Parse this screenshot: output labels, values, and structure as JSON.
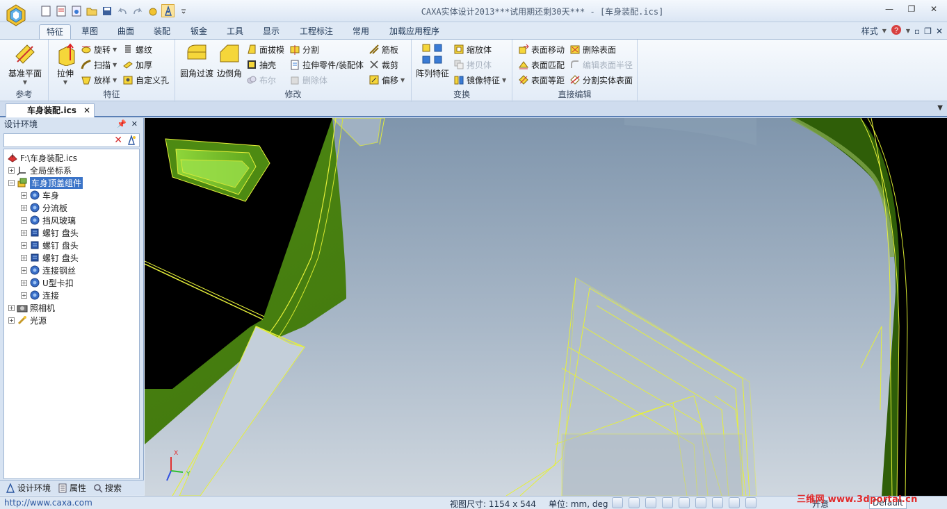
{
  "window": {
    "title": "CAXA实体设计2013***试用期还剩30天*** - [车身装配.ics]"
  },
  "ribbon_tabs": [
    "特征",
    "草图",
    "曲面",
    "装配",
    "钣金",
    "工具",
    "显示",
    "工程标注",
    "常用",
    "加载应用程序"
  ],
  "ribbon_right": {
    "style_label": "样式"
  },
  "groups": {
    "reference": {
      "label": "参考",
      "plane": "基准平面"
    },
    "feature": {
      "label": "特征",
      "extrude": "拉伸",
      "revolve": "旋转",
      "sweep": "扫描",
      "loft": "放样",
      "thread": "螺纹",
      "thicken": "加厚",
      "custom_hole": "自定义孔"
    },
    "modify": {
      "label": "修改",
      "fillet": "圆角过渡",
      "chamfer": "边倒角",
      "draft": "面拔模",
      "shell": "抽壳",
      "boolean": "布尔",
      "split": "分割",
      "pull_part": "拉伸零件/装配体",
      "delete_body": "删除体",
      "rib": "筋板",
      "trim": "裁剪",
      "offset": "偏移"
    },
    "transform": {
      "label": "变换",
      "pattern": "阵列特征",
      "scale": "缩放体",
      "copy": "拷贝体",
      "mirror": "镜像特征"
    },
    "direct_edit": {
      "label": "直接编辑",
      "move_face": "表面移动",
      "match_face": "表面匹配",
      "offset_face": "表面等距",
      "delete_face": "删除表面",
      "edit_radius": "编辑表面半径",
      "split_solid": "分割实体表面"
    }
  },
  "document_tab": {
    "label": "车身装配.ics"
  },
  "panel": {
    "title": "设计环境",
    "tree": {
      "root": "F:\\车身装配.ics",
      "items": [
        {
          "label": "全局坐标系",
          "level": 1
        },
        {
          "label": "车身顶盖组件",
          "level": 1,
          "selected": true
        },
        {
          "label": "车身",
          "level": 2
        },
        {
          "label": "分流板",
          "level": 2
        },
        {
          "label": "挡风玻璃",
          "level": 2
        },
        {
          "label": "螺钉  盘头",
          "level": 2
        },
        {
          "label": "螺钉  盘头",
          "level": 2
        },
        {
          "label": "螺钉  盘头",
          "level": 2
        },
        {
          "label": "连接钢丝",
          "level": 2
        },
        {
          "label": "U型卡扣",
          "level": 2
        },
        {
          "label": "连接",
          "level": 2
        },
        {
          "label": "照相机",
          "level": 1
        },
        {
          "label": "光源",
          "level": 1
        }
      ]
    },
    "footer_tabs": [
      "设计环境",
      "属性",
      "搜索"
    ]
  },
  "viewport": {
    "axis_x": "X",
    "axis_y": "Y"
  },
  "statusbar": {
    "url": "http://www.caxa.com",
    "view_size": "视图尺寸: 1154 x  544",
    "units": "单位: mm, deg",
    "mode": "开意",
    "renderer": "Default",
    "watermark": "三维网 www.3dportal.cn"
  },
  "colors": {
    "green": "#4f8a10",
    "accent": "#3b74c8",
    "outline": "#f0ff3c"
  }
}
